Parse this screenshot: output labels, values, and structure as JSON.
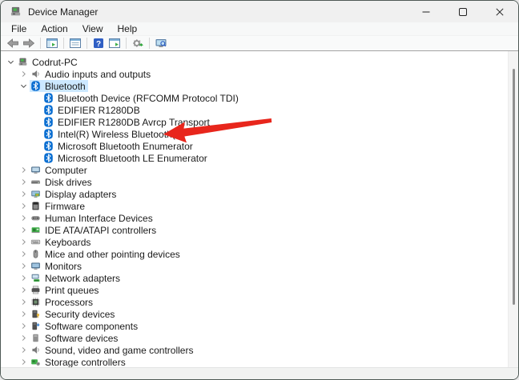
{
  "window": {
    "title": "Device Manager"
  },
  "titlebar": {
    "app_icon": "device-manager-icon",
    "controls": [
      {
        "name": "minimize-button",
        "icon": "minimize-icon"
      },
      {
        "name": "maximize-button",
        "icon": "maximize-icon"
      },
      {
        "name": "close-button",
        "icon": "close-icon"
      }
    ]
  },
  "menu": {
    "items": [
      "File",
      "Action",
      "View",
      "Help"
    ]
  },
  "toolbar": {
    "groups": [
      [
        {
          "name": "back-button",
          "icon": "arrow-left-icon"
        },
        {
          "name": "forward-button",
          "icon": "arrow-right-icon"
        }
      ],
      [
        {
          "name": "show-hide-console-tree-button",
          "icon": "console-tree-icon"
        }
      ],
      [
        {
          "name": "properties-button",
          "icon": "properties-window-icon"
        }
      ],
      [
        {
          "name": "help-button",
          "icon": "help-icon"
        },
        {
          "name": "action-pane-button",
          "icon": "action-pane-icon"
        }
      ],
      [
        {
          "name": "scan-hardware-changes-button",
          "icon": "scan-hardware-icon"
        }
      ],
      [
        {
          "name": "search-computers-button",
          "icon": "computer-search-icon"
        }
      ]
    ]
  },
  "tree": {
    "items": [
      {
        "label": "Codrut-PC",
        "level": 0,
        "state": "expanded",
        "icon": "computer-device-icon"
      },
      {
        "label": "Audio inputs and outputs",
        "level": 1,
        "state": "collapsed",
        "icon": "audio-icon"
      },
      {
        "label": "Bluetooth",
        "level": 1,
        "state": "expanded",
        "icon": "bluetooth-icon",
        "selected": true
      },
      {
        "label": "Bluetooth Device (RFCOMM Protocol TDI)",
        "level": 2,
        "icon": "bluetooth-icon"
      },
      {
        "label": "EDIFIER R1280DB",
        "level": 2,
        "icon": "bluetooth-icon"
      },
      {
        "label": "EDIFIER R1280DB Avrcp Transport",
        "level": 2,
        "icon": "bluetooth-icon"
      },
      {
        "label": "Intel(R) Wireless Bluetooth(R)",
        "level": 2,
        "icon": "bluetooth-icon",
        "arrow_target": true
      },
      {
        "label": "Microsoft Bluetooth Enumerator",
        "level": 2,
        "icon": "bluetooth-icon"
      },
      {
        "label": "Microsoft Bluetooth LE Enumerator",
        "level": 2,
        "icon": "bluetooth-icon"
      },
      {
        "label": "Computer",
        "level": 1,
        "state": "collapsed",
        "icon": "computer-icon"
      },
      {
        "label": "Disk drives",
        "level": 1,
        "state": "collapsed",
        "icon": "disk-icon"
      },
      {
        "label": "Display adapters",
        "level": 1,
        "state": "collapsed",
        "icon": "display-icon"
      },
      {
        "label": "Firmware",
        "level": 1,
        "state": "collapsed",
        "icon": "firmware-icon"
      },
      {
        "label": "Human Interface Devices",
        "level": 1,
        "state": "collapsed",
        "icon": "hid-icon"
      },
      {
        "label": "IDE ATA/ATAPI controllers",
        "level": 1,
        "state": "collapsed",
        "icon": "ide-icon"
      },
      {
        "label": "Keyboards",
        "level": 1,
        "state": "collapsed",
        "icon": "keyboard-icon"
      },
      {
        "label": "Mice and other pointing devices",
        "level": 1,
        "state": "collapsed",
        "icon": "mouse-icon"
      },
      {
        "label": "Monitors",
        "level": 1,
        "state": "collapsed",
        "icon": "monitor-icon"
      },
      {
        "label": "Network adapters",
        "level": 1,
        "state": "collapsed",
        "icon": "network-icon"
      },
      {
        "label": "Print queues",
        "level": 1,
        "state": "collapsed",
        "icon": "printer-icon"
      },
      {
        "label": "Processors",
        "level": 1,
        "state": "collapsed",
        "icon": "processor-icon"
      },
      {
        "label": "Security devices",
        "level": 1,
        "state": "collapsed",
        "icon": "security-icon"
      },
      {
        "label": "Software components",
        "level": 1,
        "state": "collapsed",
        "icon": "software-components-icon"
      },
      {
        "label": "Software devices",
        "level": 1,
        "state": "collapsed",
        "icon": "software-devices-icon"
      },
      {
        "label": "Sound, video and game controllers",
        "level": 1,
        "state": "collapsed",
        "icon": "sound-icon"
      },
      {
        "label": "Storage controllers",
        "level": 1,
        "state": "collapsed",
        "icon": "storage-icon"
      }
    ]
  },
  "annotation": {
    "shape": "red-arrow-pointing-left",
    "points_at": "Intel(R) Wireless Bluetooth(R)"
  },
  "colors": {
    "titlebar_bg": "#f0f0f0",
    "selection_highlight": "#cce8ff",
    "annotation_arrow_red": "#e8261c",
    "bluetooth_blue": "#0a6ed1"
  }
}
